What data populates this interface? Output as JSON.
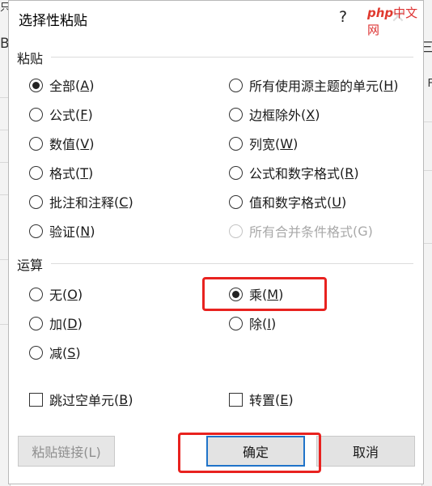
{
  "dialog": {
    "title": "选择性粘贴",
    "help_glyph": "?",
    "close_glyph": "✕"
  },
  "watermark": {
    "php": "php",
    "cn": "中文网"
  },
  "background": {
    "left_letter": "B",
    "right_letter": "三",
    "top_right_char": "F",
    "top_left_char": "只"
  },
  "paste_section": {
    "label": "粘贴",
    "options": [
      {
        "label": "全部",
        "key": "A",
        "checked": true
      },
      {
        "label": "公式",
        "key": "F"
      },
      {
        "label": "数值",
        "key": "V"
      },
      {
        "label": "格式",
        "key": "T"
      },
      {
        "label": "批注和注释",
        "key": "C"
      },
      {
        "label": "验证",
        "key": "N"
      },
      {
        "label": "所有使用源主题的单元",
        "key": "H"
      },
      {
        "label": "边框除外",
        "key": "X"
      },
      {
        "label": "列宽",
        "key": "W"
      },
      {
        "label": "公式和数字格式",
        "key": "R"
      },
      {
        "label": "值和数字格式",
        "key": "U"
      },
      {
        "label": "所有合并条件格式",
        "key": "G",
        "disabled": true
      }
    ]
  },
  "operation_section": {
    "label": "运算",
    "options": [
      {
        "label": "无",
        "key": "O"
      },
      {
        "label": "加",
        "key": "D"
      },
      {
        "label": "减",
        "key": "S"
      },
      {
        "label": "乘",
        "key": "M",
        "checked": true
      },
      {
        "label": "除",
        "key": "I"
      }
    ]
  },
  "checkboxes": [
    {
      "label": "跳过空单元",
      "key": "B",
      "checked": false
    },
    {
      "label": "转置",
      "key": "E",
      "checked": false
    }
  ],
  "buttons": {
    "paste_link": "粘贴链接(L)",
    "ok": "确定",
    "cancel": "取消"
  },
  "colors": {
    "highlight": "#e8221f",
    "ok_focus_border": "#1f73c9",
    "disabled_text": "#a8a8a8"
  }
}
